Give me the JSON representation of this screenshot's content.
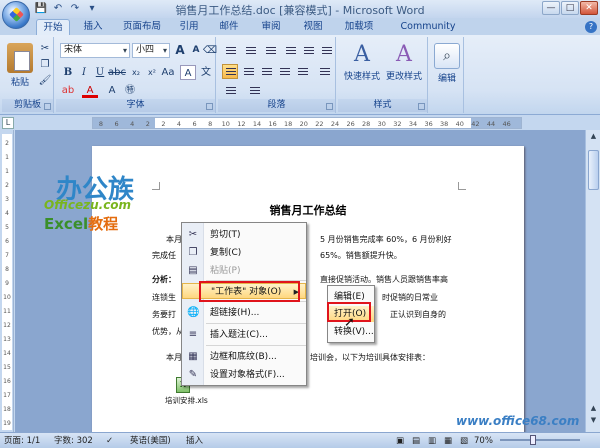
{
  "window": {
    "title": "销售月工作总结.doc [兼容模式] - Microsoft Word",
    "controls": [
      "—",
      "□",
      "✕"
    ]
  },
  "quick_access": [
    "save",
    "undo",
    "redo",
    "more"
  ],
  "tabs": [
    "开始",
    "插入",
    "页面布局",
    "引用",
    "邮件",
    "审阅",
    "视图",
    "加载项",
    "Community Clips"
  ],
  "ribbon": {
    "clipboard": {
      "label": "剪贴板",
      "paste": "粘贴"
    },
    "font": {
      "label": "字体",
      "name": "宋体",
      "size": "小四",
      "grow": "A",
      "shrink": "A"
    },
    "paragraph": {
      "label": "段落"
    },
    "styles": {
      "label": "样式",
      "quick": "快速样式",
      "change": "更改样式"
    },
    "editing": {
      "label": "编辑"
    }
  },
  "ruler": {
    "ticks": [
      "8",
      "6",
      "4",
      "2",
      "2",
      "4",
      "6",
      "8",
      "10",
      "12",
      "14",
      "16",
      "18",
      "20",
      "22",
      "24",
      "26",
      "28",
      "30",
      "32",
      "34",
      "36",
      "38",
      "40",
      "42",
      "44",
      "46"
    ]
  },
  "vruler": {
    "ticks": [
      "2",
      "1",
      "1",
      "2",
      "3",
      "4",
      "5",
      "6",
      "7",
      "8",
      "9",
      "10",
      "11",
      "12",
      "13",
      "14",
      "15",
      "16",
      "17",
      "18",
      "19"
    ]
  },
  "document": {
    "title": "销售月工作总结",
    "lines": [
      "本月",
      "5 月份销售完成率 60%，6 月份利好",
      "完成任",
      "65%。销售额提升快。",
      "分析：",
      "直接促销活动。销售人员跟销售率高",
      "连锁生",
      "时促销的日常业",
      "务要打",
      "正认识到自身的",
      "优势，从",
      "本月",
      "培训会，以下为培训具体安排表：",
      "培训安排.xls"
    ]
  },
  "context_menu": [
    {
      "icon": "scissors-icon",
      "glyph": "✂",
      "label": "剪切(T)",
      "disabled": false
    },
    {
      "icon": "copy-icon",
      "glyph": "❐",
      "label": "复制(C)",
      "disabled": false
    },
    {
      "icon": "paste-icon",
      "glyph": "▤",
      "label": "粘贴(P)",
      "disabled": true
    },
    {
      "icon": "",
      "glyph": "",
      "label": "\"工作表\" 对象(O)",
      "disabled": false
    },
    {
      "icon": "hyperlink-icon",
      "glyph": "🌐",
      "label": "超链接(H)...",
      "disabled": false
    },
    {
      "icon": "caption-icon",
      "glyph": "≡",
      "label": "插入题注(C)...",
      "disabled": false
    },
    {
      "icon": "border-icon",
      "glyph": "▦",
      "label": "边框和底纹(B)...",
      "disabled": false
    },
    {
      "icon": "format-icon",
      "glyph": "✎",
      "label": "设置对象格式(F)...",
      "disabled": false
    }
  ],
  "submenu": [
    "编辑(E)",
    "打开(O)",
    "转换(V)..."
  ],
  "watermark": {
    "brand": "办公族",
    "site": "Officezu.com",
    "excel": "Excel",
    "tutorial": "教程",
    "corner_site": "www.office68.com"
  },
  "status": {
    "page": "页面: 1/1",
    "words": "字数: 302",
    "language": "英语(美国)",
    "mode": "插入",
    "zoom": "70%"
  },
  "colors": {
    "highlight_border": "#e0141c",
    "ribbon_bg": "#d6e3f4",
    "menu_highlight": "#ffd77f"
  }
}
